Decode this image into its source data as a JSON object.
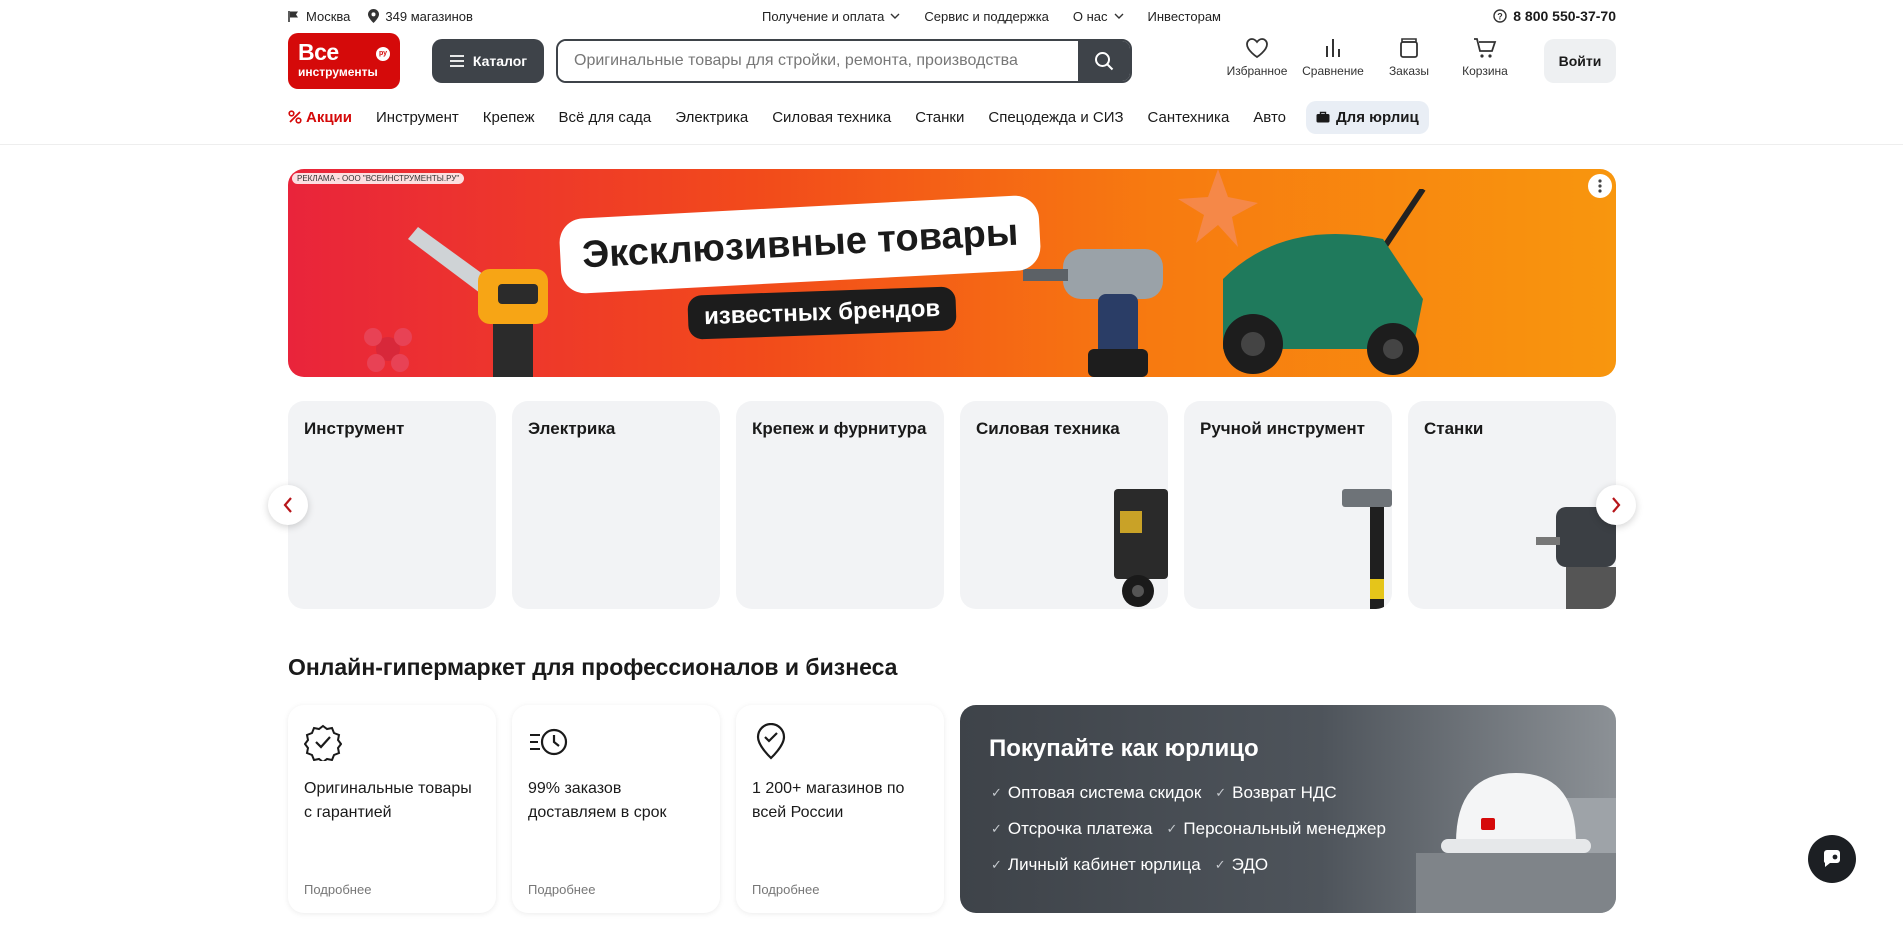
{
  "topbar": {
    "city": "Москва",
    "stores": "349 магазинов",
    "links": [
      "Получение и оплата",
      "Сервис и поддержка",
      "О нас",
      "Инвесторам"
    ],
    "phone": "8 800 550-37-70"
  },
  "header": {
    "logo_line1": "Все",
    "logo_line2": "инструменты",
    "logo_badge": "ру",
    "catalog_label": "Каталог",
    "search_placeholder": "Оригинальные товары для стройки, ремонта, производства",
    "icons": [
      {
        "label": "Избранное",
        "icon": "heart-icon"
      },
      {
        "label": "Сравнение",
        "icon": "compare-icon"
      },
      {
        "label": "Заказы",
        "icon": "orders-icon"
      },
      {
        "label": "Корзина",
        "icon": "cart-icon"
      }
    ],
    "login_label": "Войти"
  },
  "nav": {
    "promo": "Акции",
    "items": [
      "Инструмент",
      "Крепеж",
      "Всё для сада",
      "Электрика",
      "Силовая техника",
      "Станки",
      "Спецодежда и СИЗ",
      "Сантехника",
      "Авто"
    ],
    "business": "Для юрлиц"
  },
  "banner": {
    "ad_label": "РЕКЛАМА - ООО \"ВСЕИНСТРУМЕНТЫ.РУ\"",
    "title": "Эксклюзивные товары",
    "subtitle": "известных брендов"
  },
  "categories": [
    "Инструмент",
    "Электрика",
    "Крепеж и фурнитура",
    "Силовая техника",
    "Ручной инструмент",
    "Станки"
  ],
  "section": {
    "title": "Онлайн-гипермаркет для профессионалов и бизнеса",
    "features": [
      {
        "text": "Оригинальные товары с гарантией",
        "more": "Подробнее",
        "icon": "badge-check-icon"
      },
      {
        "text": "99% заказов доставляем в срок",
        "more": "Подробнее",
        "icon": "fast-clock-icon"
      },
      {
        "text": "1 200+ магазинов по всей России",
        "more": "Подробнее",
        "icon": "location-check-icon"
      }
    ],
    "business": {
      "title": "Покупайте как юрлицо",
      "rows": [
        [
          "Оптовая система скидок",
          "Возврат НДС"
        ],
        [
          "Отсрочка платежа",
          "Персональный менеджер"
        ],
        [
          "Личный кабинет юрлица",
          "ЭДО"
        ]
      ]
    }
  },
  "colors": {
    "brand": "#d50a0a",
    "dark": "#3e4349"
  }
}
